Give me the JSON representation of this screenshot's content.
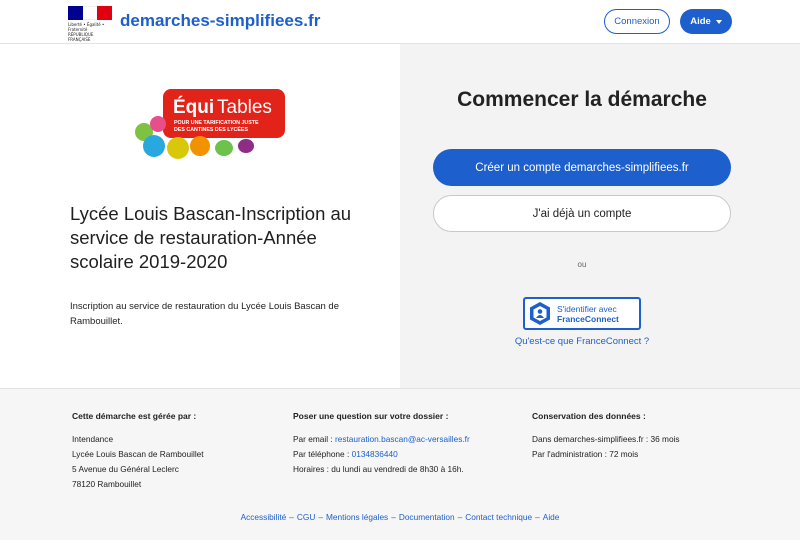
{
  "header": {
    "site_name": "demarches-simplifiees.fr",
    "marianne_text": "Liberté • Égalité • Fraternité RÉPUBLIQUE FRANÇAISE",
    "connexion_label": "Connexion",
    "aide_label": "Aide"
  },
  "procedure": {
    "logo_text_main_1": "Équi",
    "logo_text_main_2": "Tables",
    "logo_text_sub_1": "POUR UNE TARIFICATION JUSTE",
    "logo_text_sub_2": "DES CANTINES DES LYCÉES",
    "title": "Lycée Louis Bascan-Inscription au service de restauration-Année scolaire 2019-2020",
    "description": "Inscription au service de restauration du Lycée Louis Bascan de Rambouillet."
  },
  "start": {
    "title": "Commencer la démarche",
    "create_account_label": "Créer un compte demarches-simplifiees.fr",
    "existing_account_label": "J'ai déjà un compte",
    "or_label": "ou",
    "fc_line1": "S'identifier avec",
    "fc_line2": "FranceConnect",
    "fc_help_link": "Qu'est-ce que FranceConnect ?"
  },
  "footer": {
    "col1": {
      "title": "Cette démarche est gérée par :",
      "lines": [
        "Intendance",
        "Lycée Louis Bascan de Rambouillet",
        "5 Avenue du Général Leclerc",
        "78120 Rambouillet"
      ]
    },
    "col2": {
      "title": "Poser une question sur votre dossier :",
      "email_prefix": "Par email : ",
      "email": "restauration.bascan@ac-versailles.fr",
      "phone_prefix": "Par téléphone : ",
      "phone": "0134836440",
      "hours": "Horaires : du lundi au vendredi de 8h30 à 16h."
    },
    "col3": {
      "title": "Conservation des données :",
      "line1": "Dans demarches-simplifiees.fr : 36 mois",
      "line2": "Par l'administration : 72 mois"
    },
    "links": [
      "Accessibilité",
      "CGU",
      "Mentions légales",
      "Documentation",
      "Contact technique",
      "Aide"
    ],
    "link_separator": "–"
  },
  "colors": {
    "accent": "#1d5fcc",
    "flag_blue": "#000091",
    "flag_red": "#e1000f",
    "logo_red": "#e2231a"
  }
}
